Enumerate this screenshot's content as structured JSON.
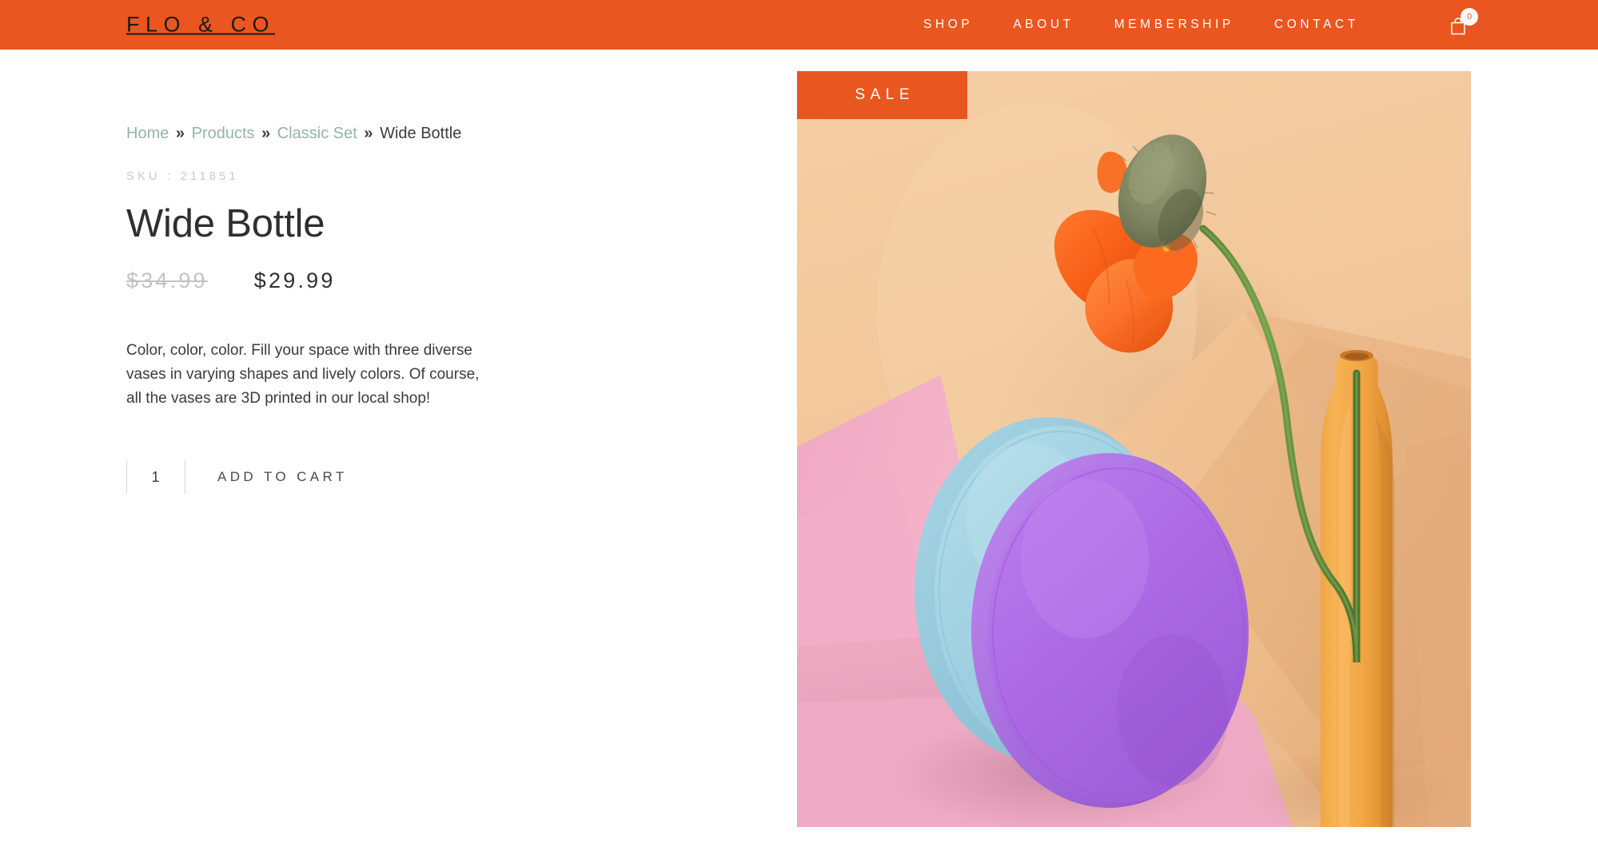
{
  "header": {
    "brand": "FLO & CO",
    "background_color": "#ea5620",
    "nav_items": [
      {
        "label": "SHOP"
      },
      {
        "label": "ABOUT"
      },
      {
        "label": "MEMBERSHIP"
      },
      {
        "label": "CONTACT"
      }
    ],
    "cart": {
      "icon": "shopping-bag-icon",
      "count": "0"
    }
  },
  "breadcrumb": {
    "items": [
      {
        "label": "Home",
        "type": "link"
      },
      {
        "label": "Products",
        "type": "link"
      },
      {
        "label": "Classic Set",
        "type": "link"
      },
      {
        "label": "Wide Bottle",
        "type": "current"
      }
    ],
    "separator": "»",
    "link_color": "#94b3ac"
  },
  "product": {
    "sku_label": "SKU : 211851",
    "title": "Wide Bottle",
    "price_original": "$34.99",
    "price_current": "$29.99",
    "description": "Color, color, color. Fill your space with three diverse vases in varying shapes and lively colors. Of course, all the vases are 3D printed in our local shop!",
    "quantity_value": "1",
    "add_to_cart_label": "ADD TO CART",
    "badge_label": "SALE",
    "image_alt": "Three 3D printed vases - light blue disc, purple disc, and orange bottle with an orange poppy flower"
  }
}
